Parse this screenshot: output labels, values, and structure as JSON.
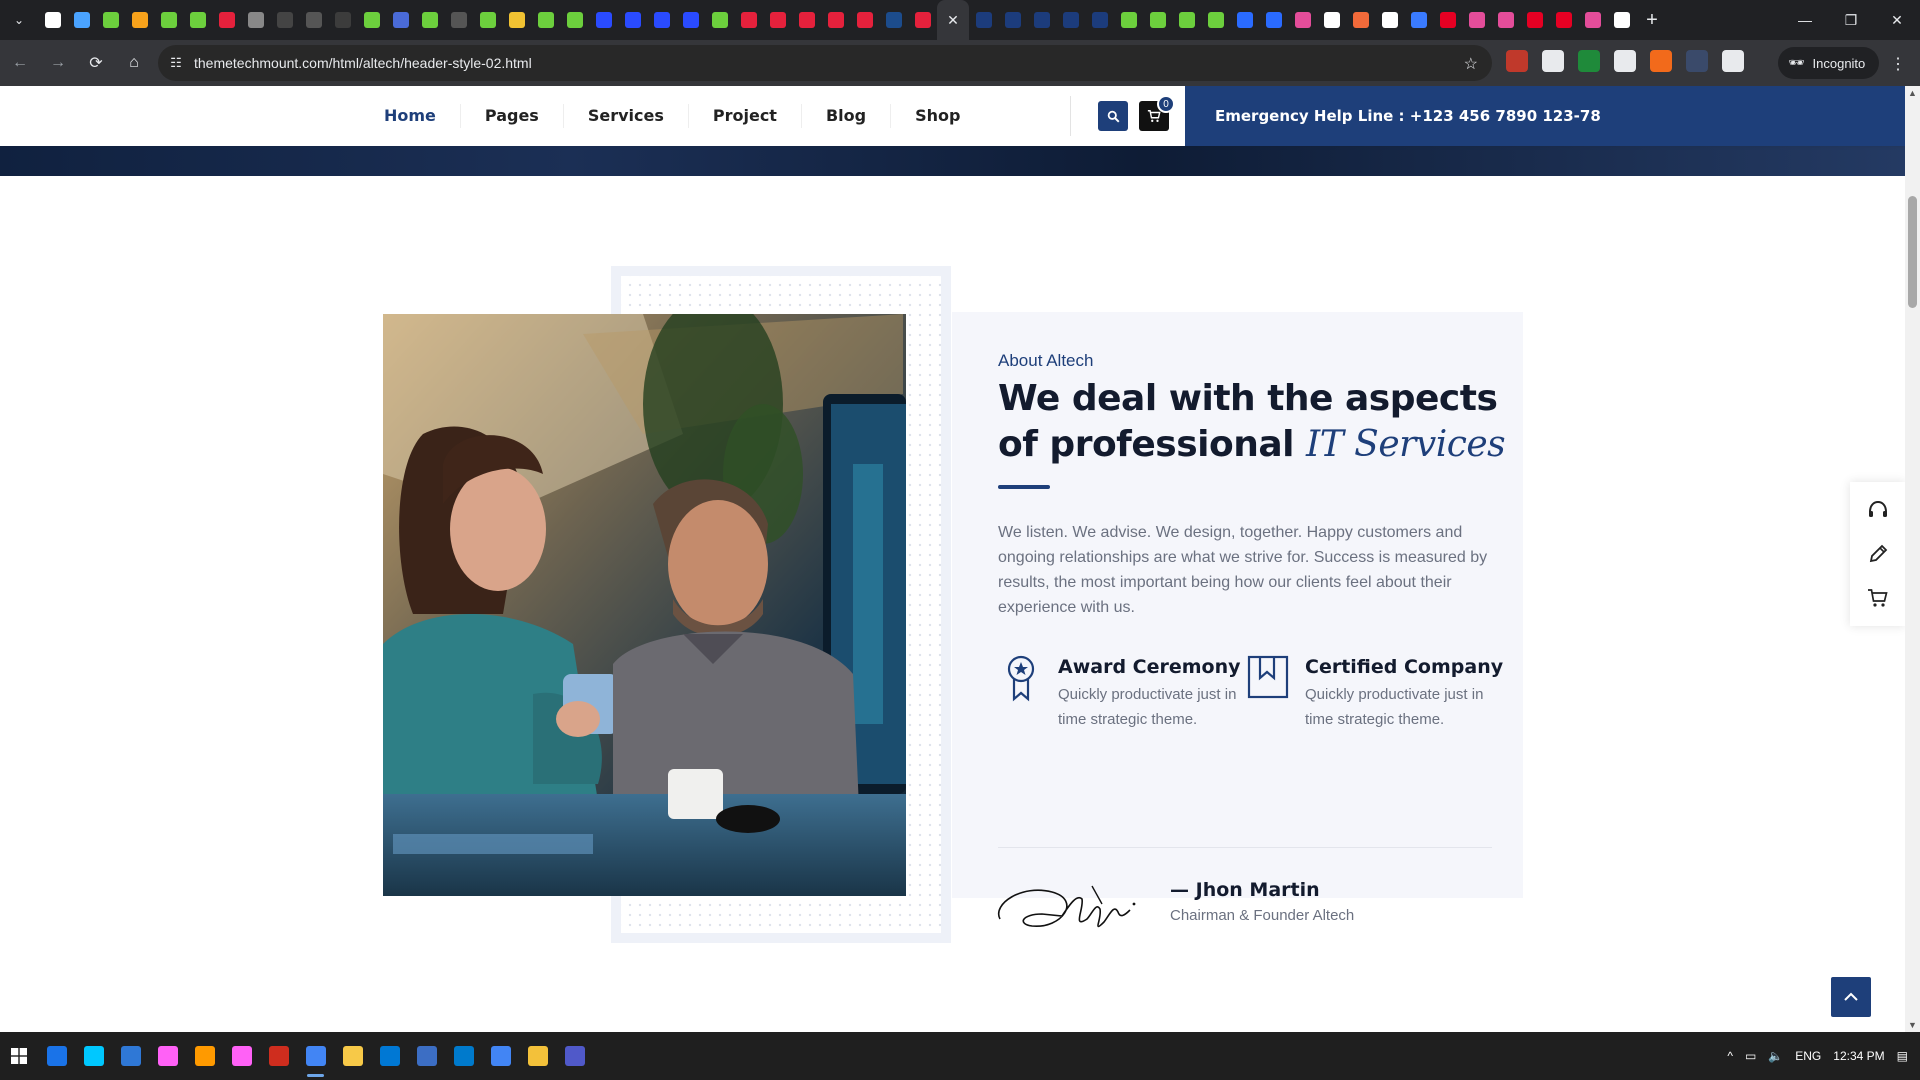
{
  "browser": {
    "address_url": "themetechmount.com/html/altech/header-style-02.html",
    "incognito_label": "Incognito",
    "tab_favicon_colors": [
      "#ffffff",
      "#4aa3ff",
      "#6ccf3d",
      "#f7a21b",
      "#6ccf3d",
      "#6ccf3d",
      "#e5213c",
      "#888888",
      "#444444",
      "#555555",
      "#3c3c3c",
      "#6ccf3d",
      "#4a6bd8",
      "#6ccf3d",
      "#555555",
      "#6ccf3d",
      "#f1c232",
      "#6ccf3d",
      "#6ccf3d",
      "#2a4bff",
      "#2a4bff",
      "#2a4bff",
      "#2a4bff",
      "#6ccf3d",
      "#e5213c",
      "#e5213c",
      "#e5213c",
      "#e5213c",
      "#e5213c",
      "#1c4c8c",
      "#e5213c"
    ],
    "tab_favicon_colors_right": [
      "#1c3c7c",
      "#1c3c7c",
      "#1c3c7c",
      "#1c3c7c",
      "#1c3c7c",
      "#6ccf3d",
      "#6ccf3d",
      "#6ccf3d",
      "#6ccf3d",
      "#2a6bff",
      "#2a6bff",
      "#e44d9a",
      "#ffffff",
      "#f26a3a",
      "#ffffff",
      "#3a7bff",
      "#e60023",
      "#e44d9a",
      "#e44d9a",
      "#e60023",
      "#e60023",
      "#e44d9a",
      "#ffffff"
    ],
    "extension_colors": [
      "#c0392b",
      "#e8eaed",
      "#1f8a3a",
      "#e8eaed",
      "#f26a1b",
      "#3a4a6a",
      "#e8eaed"
    ]
  },
  "header": {
    "nav": [
      "Home",
      "Pages",
      "Services",
      "Project",
      "Blog",
      "Shop"
    ],
    "active_nav": "Home",
    "cart_count": "0",
    "helpline": "Emergency Help Line : +123 456 7890 123-78"
  },
  "about": {
    "eyebrow": "About Altech",
    "heading_plain": "We deal with the aspects of professional",
    "heading_accent": "IT Services",
    "paragraph": "We listen. We advise. We design, together. Happy customers and ongoing relationships are what we strive for. Success is measured by results, the most important being how our clients feel about their experience with us.",
    "features": [
      {
        "icon": "award-ribbon-icon",
        "title": "Award Ceremony",
        "text": "Quickly productivate just in time strategic theme."
      },
      {
        "icon": "bookmark-icon",
        "title": "Certified Company",
        "text": "Quickly productivate just in time strategic theme."
      }
    ],
    "founder_name": "Jhon Martin",
    "founder_role": "Chairman & Founder Altech"
  },
  "side_panel": [
    "headset-icon",
    "pencil-icon",
    "cart-icon"
  ],
  "taskbar": {
    "app_colors": [
      "#1a73e8",
      "#00c8ff",
      "#2f78d6",
      "#ff61f6",
      "#ff9a00",
      "#ff61f6",
      "#cf2d1e",
      "#4285f4",
      "#f7c948",
      "#0078d4",
      "#3c6ec4",
      "#007acc",
      "#4285f4",
      "#f3c13a",
      "#5059c9"
    ],
    "language": "ENG",
    "time": "12:34 PM"
  },
  "colors": {
    "brand": "#1e3f7a",
    "heading": "#131b2e",
    "body_text": "#6b7180"
  }
}
